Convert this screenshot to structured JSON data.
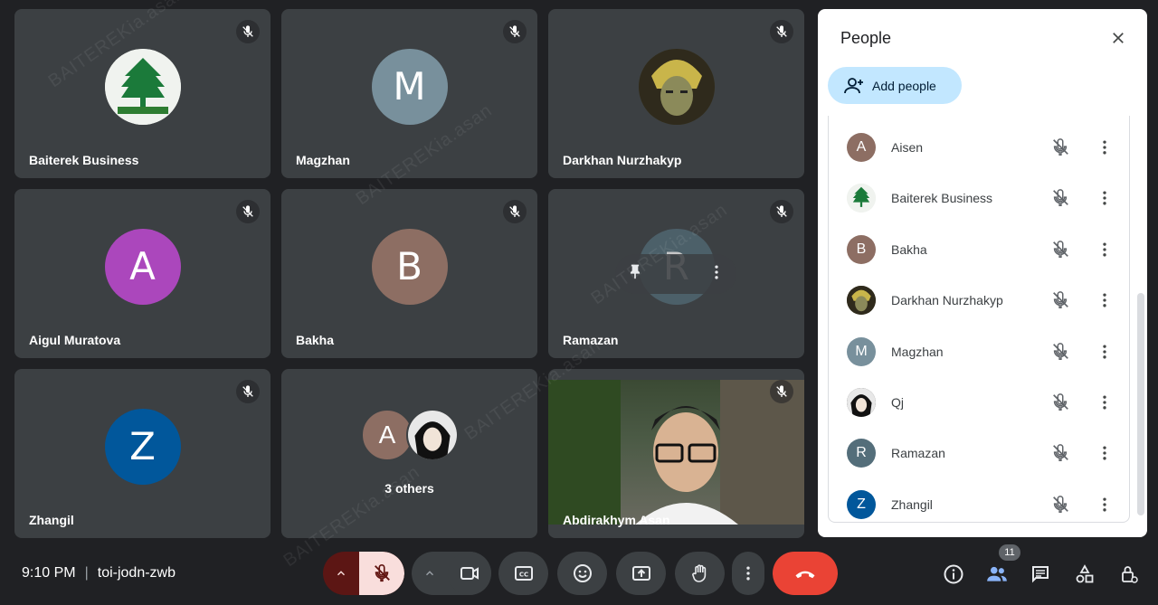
{
  "watermark": "BAITEREKia.asan",
  "tiles": [
    {
      "name": "Baiterek Business",
      "avatar_letter": "",
      "avatar_color": "#e9eee9"
    },
    {
      "name": "Magzhan",
      "avatar_letter": "M",
      "avatar_color": "#78909c"
    },
    {
      "name": "Darkhan Nurzhakyp",
      "avatar_letter": "",
      "avatar_color": "#4a4a2c"
    },
    {
      "name": "Aigul Muratova",
      "avatar_letter": "A",
      "avatar_color": "#ab47bc"
    },
    {
      "name": "Bakha",
      "avatar_letter": "B",
      "avatar_color": "#8d6e63"
    },
    {
      "name": "Ramazan",
      "avatar_letter": "R",
      "avatar_color": "#546e7a"
    },
    {
      "name": "Zhangil",
      "avatar_letter": "Z",
      "avatar_color": "#01579b"
    },
    {
      "name": "",
      "others_label": "3 others",
      "avatar_letter": "A",
      "avatar_color": "#8d6e63"
    },
    {
      "name": "Abdirakhym Asan",
      "avatar_letter": "",
      "avatar_color": "#3c4043"
    }
  ],
  "bottom_bar": {
    "time": "9:10 PM",
    "meeting_code": "toi-jodn-zwb",
    "participant_count": "11",
    "end_call_color": "#ea4335",
    "mic_off_color": "#f9dedc"
  },
  "people_panel": {
    "title": "People",
    "add_people_label": "Add people",
    "participants": [
      {
        "name": "Aisen",
        "letter": "A",
        "color": "#8d6e63"
      },
      {
        "name": "Baiterek Business",
        "letter": "",
        "color": "#e9eee9"
      },
      {
        "name": "Bakha",
        "letter": "B",
        "color": "#8d6e63"
      },
      {
        "name": "Darkhan Nurzhakyp",
        "letter": "",
        "color": "#4a4a2c"
      },
      {
        "name": "Magzhan",
        "letter": "M",
        "color": "#78909c"
      },
      {
        "name": "Qj",
        "letter": "",
        "color": "#222222"
      },
      {
        "name": "Ramazan",
        "letter": "R",
        "color": "#546e7a"
      },
      {
        "name": "Zhangil",
        "letter": "Z",
        "color": "#01579b"
      }
    ]
  }
}
